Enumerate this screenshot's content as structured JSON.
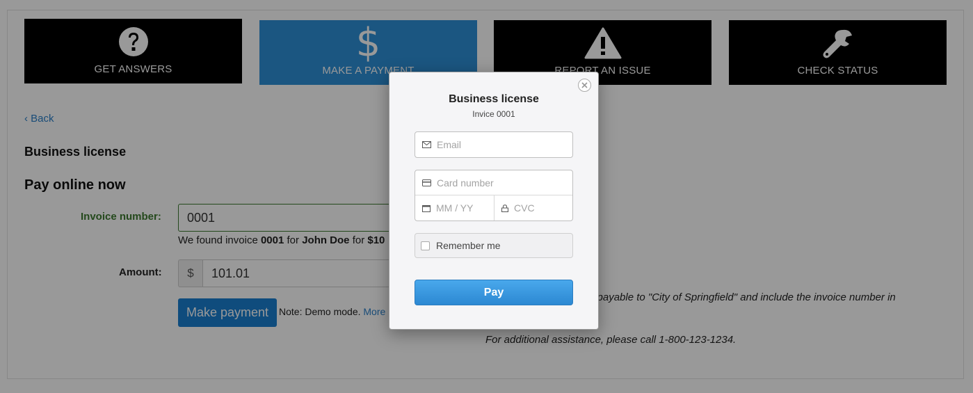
{
  "tiles": [
    {
      "label": "GET ANSWERS",
      "icon": "question-circle-icon"
    },
    {
      "label": "MAKE A PAYMENT",
      "icon": "dollar-icon"
    },
    {
      "label": "REPORT AN ISSUE",
      "icon": "warning-icon"
    },
    {
      "label": "CHECK STATUS",
      "icon": "wrench-icon"
    }
  ],
  "back_label": "Back",
  "page_title": "Business license",
  "pay_online_heading": "Pay online now",
  "right_heading_visible": "y",
  "invoice": {
    "label": "Invoice number:",
    "value": "0001",
    "found_prefix": "We found invoice ",
    "found_invoice": "0001",
    "found_for": " for ",
    "found_name": "John Doe",
    "found_for2": " for ",
    "found_amount": "$10"
  },
  "amount": {
    "label": "Amount:",
    "prefix": "$",
    "value": "101.01"
  },
  "make_payment_label": "Make payment",
  "note_text": "Note: Demo mode. ",
  "note_link": "More",
  "check_text_visible": "e payable to \"City of Springfield\" and include the invoice number in",
  "assistance_text": "For additional assistance, please call 1-800-123-1234.",
  "modal": {
    "title": "Business license",
    "subtitle": "Invice 0001",
    "email_placeholder": "Email",
    "card_placeholder": "Card number",
    "expiry_placeholder": "MM / YY",
    "cvc_placeholder": "CVC",
    "remember_label": "Remember me",
    "pay_label": "Pay"
  },
  "colors": {
    "active_tile": "#2e8fd8",
    "primary_button": "#1a7fd0",
    "valid_green": "#3c7a2f",
    "overlay": "rgba(0,0,0,0.4)"
  }
}
